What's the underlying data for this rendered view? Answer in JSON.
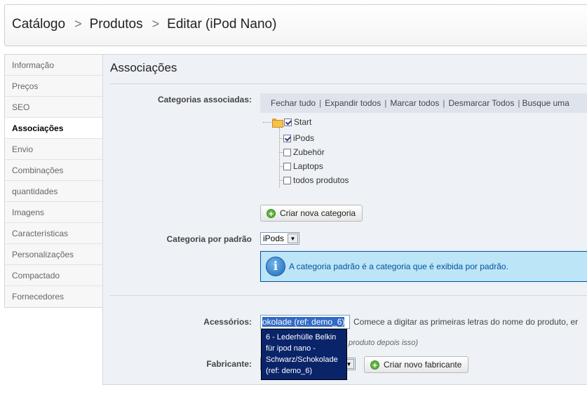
{
  "breadcrumb": {
    "items": [
      "Catálogo",
      "Produtos",
      "Editar (iPod Nano)"
    ],
    "separator": ">"
  },
  "sidebar": {
    "items": [
      {
        "label": "Informação"
      },
      {
        "label": "Preços"
      },
      {
        "label": "SEO"
      },
      {
        "label": "Associações",
        "active": true
      },
      {
        "label": "Envio"
      },
      {
        "label": "Combinações"
      },
      {
        "label": "quantidades"
      },
      {
        "label": "Imagens"
      },
      {
        "label": "Características"
      },
      {
        "label": "Personalizações"
      },
      {
        "label": "Compactado"
      },
      {
        "label": "Fornecedores"
      }
    ]
  },
  "panel": {
    "title": "Associações",
    "categories_label": "Categorias associadas:",
    "toolbar": {
      "collapse_all": "Fechar tudo",
      "expand_all": "Expandir todos",
      "check_all": "Marcar todos",
      "uncheck_all": "Desmarcar Todos",
      "search": "Busque uma"
    },
    "tree": {
      "root": {
        "label": "Start",
        "checked": true
      },
      "children": [
        {
          "label": "iPods",
          "checked": true
        },
        {
          "label": "Zubehör",
          "checked": false
        },
        {
          "label": "Laptops",
          "checked": false
        },
        {
          "label": "todos produtos",
          "checked": false
        }
      ]
    },
    "new_category_button": "Criar nova categoria",
    "default_category_label": "Categoria por padrão",
    "default_category_value": "iPods",
    "info_text": "A categoria padrão é a categoria que é exibida por padrão.",
    "accessories_label": "Acessórios:",
    "accessories_input_value": "okolade (ref: demo_6)",
    "accessories_hint": "Comece a digitar as primeiras letras do nome do produto, er",
    "accessories_hint_secondary": "produto depois isso)",
    "autocomplete": {
      "items": [
        "6 - Lederhülle Belkin für ipod nano - Schwarz/Schokolade (ref: demo_6)"
      ]
    },
    "manufacturer_label": "Fabricante:",
    "new_manufacturer_button": "Criar novo fabricante"
  },
  "colors": {
    "panel_bg": "#eef1f6",
    "info_bg": "#bde5f8",
    "info_border": "#00529b",
    "autocomplete_bg": "#0a246a",
    "selection": "#316ac5"
  }
}
